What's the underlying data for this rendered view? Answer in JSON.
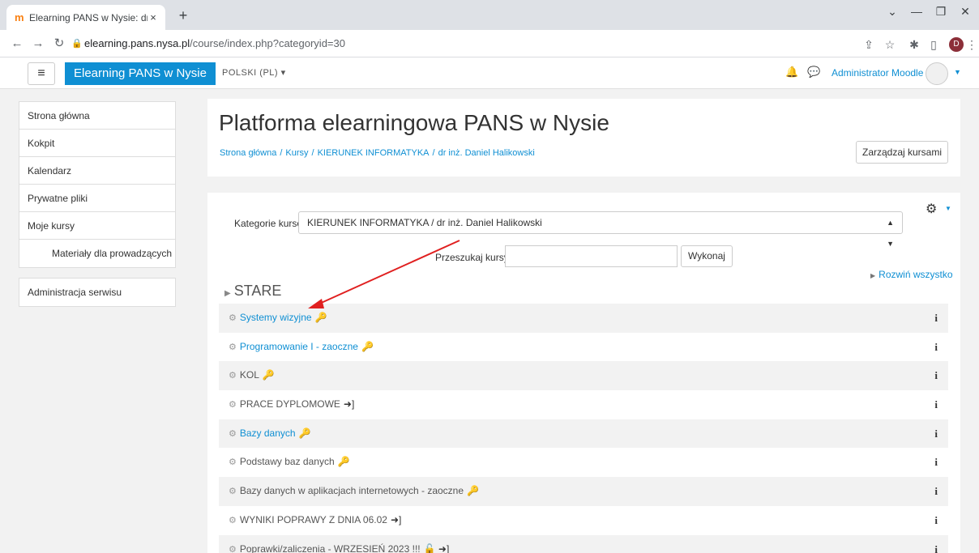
{
  "browser": {
    "tab_title": "Elearning PANS w Nysie: dr inż. D",
    "tab_close": "×",
    "new_tab": "+",
    "favicon": "m",
    "url_host": "elearning.pans.nysa.pl",
    "url_path": "/course/index.php?categoryid=30",
    "profile_initial": "D",
    "icons": [
      "back-icon",
      "forward-icon",
      "reload-icon",
      "lock-icon",
      "share-icon",
      "star-icon",
      "extensions-icon",
      "sidepanel-icon",
      "menu-icon"
    ]
  },
  "navbar": {
    "brand": "Elearning PANS w Nysie",
    "language": "POLSKI (PL) ▾",
    "user_name": "Administrator Moodle"
  },
  "sidebar": {
    "nav": [
      {
        "label": "Strona główna"
      },
      {
        "label": "Kokpit"
      },
      {
        "label": "Kalendarz"
      },
      {
        "label": "Prywatne pliki"
      },
      {
        "label": "Moje kursy"
      },
      {
        "label": "Materiały dla prowadzących"
      }
    ],
    "admin": {
      "label": "Administracja serwisu"
    }
  },
  "header": {
    "title": "Platforma elearningowa PANS w Nysie",
    "breadcrumb": [
      "Strona główna",
      "Kursy",
      "KIERUNEK INFORMATYKA",
      "dr inż. Daniel Halikowski"
    ],
    "separator": "/",
    "manage_button": "Zarządzaj kursami"
  },
  "main": {
    "category_label": "Kategorie kursów:",
    "category_value": "KIERUNEK INFORMATYKA / dr inż. Daniel Halikowski",
    "search_label": "Przeszukaj kursy",
    "search_value": "",
    "search_button": "Wykonaj",
    "expand_all": "Rozwiń wszystko",
    "section_title": "STARE",
    "courses": [
      {
        "name": "Systemy wizyjne",
        "link": true,
        "icons": "🔑"
      },
      {
        "name": "Programowanie I - zaoczne",
        "link": true,
        "icons": "🔑"
      },
      {
        "name": "KOL",
        "link": false,
        "icons": "🔑"
      },
      {
        "name": "PRACE DYPLOMOWE",
        "link": false,
        "icons": "➜]"
      },
      {
        "name": "Bazy danych",
        "link": true,
        "icons": "🔑"
      },
      {
        "name": "Podstawy baz danych",
        "link": false,
        "icons": "🔑"
      },
      {
        "name": "Bazy danych w aplikacjach internetowych - zaoczne",
        "link": false,
        "icons": "🔑"
      },
      {
        "name": "WYNIKI POPRAWY Z DNIA 06.02",
        "link": false,
        "icons": "➜]"
      },
      {
        "name": "Poprawki/zaliczenia - WRZESIEŃ 2023 !!!",
        "link": false,
        "icons": "🔓 ➜]"
      }
    ]
  },
  "colors": {
    "accent": "#0f8fd3",
    "annotation": "#e02020"
  }
}
